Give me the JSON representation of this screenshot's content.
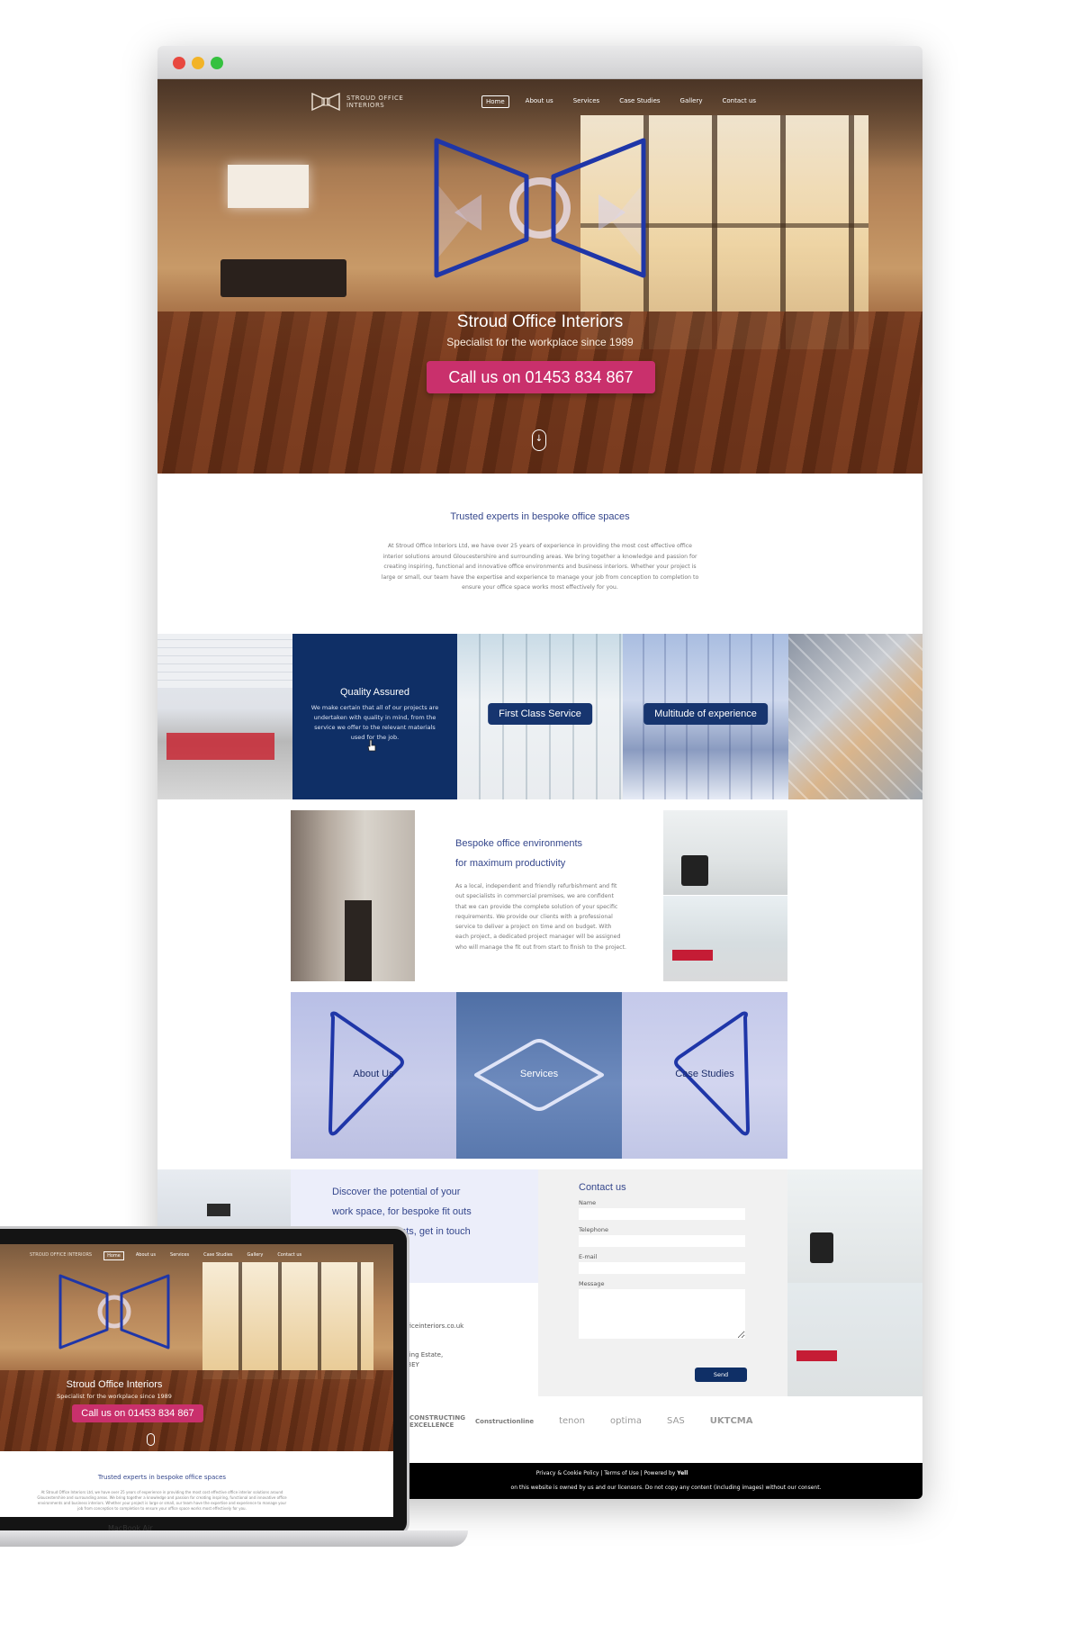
{
  "site": {
    "logo_text": "STROUD OFFICE INTERIORS",
    "nav": [
      "Home",
      "About us",
      "Services",
      "Case Studies",
      "Gallery",
      "Contact us"
    ],
    "active_nav": "Home"
  },
  "hero": {
    "title": "Stroud Office Interiors",
    "subtitle": "Specialist for the workplace since 1989",
    "cta": "Call us on 01453 834 867",
    "scroll_icon": "arrow-down-icon"
  },
  "intro": {
    "title": "Trusted experts in bespoke office spaces",
    "text": "At Stroud Office Interiors Ltd, we have over 25 years of experience in providing the most cost effective office interior solutions around Gloucestershire and surrounding areas. We bring together a knowledge and passion for creating inspiring, functional and innovative office environments and business interiors. Whether your project is large or small, our team have the expertise and experience to manage your job from conception to completion to ensure your office space works most effectively for you."
  },
  "features": {
    "quality_title": "Quality Assured",
    "quality_text": "We make certain that all of our projects are undertaken with quality in mind, from the service we offer to the relevant materials used for the job.",
    "service_label": "First Class Service",
    "experience_label": "Multitude of experience"
  },
  "bespoke": {
    "title_line1": "Bespoke office environments",
    "title_line2": "for maximum productivity",
    "text": "As a local, independent and friendly refurbishment and fit out specialists in commercial premises, we are confident that we can provide the complete solution of your specific requirements. We provide our clients with a professional service to deliver a project on time and on budget. With each project, a dedicated project manager will be assigned who will manage the fit out from start to finish to the project."
  },
  "tiles": [
    "About Us",
    "Services",
    "Case Studies"
  ],
  "discover": {
    "line1": "Discover the potential of your",
    "line2": "work space, for bespoke fit outs",
    "line3": "ents, get in touch"
  },
  "contact": {
    "title": "Contact us",
    "fields": [
      "Name",
      "Telephone",
      "E-mail",
      "Message"
    ],
    "send": "Send",
    "email_fragment": "officeinteriors.co.uk",
    "address_fragment1": "ading Estate,",
    "address_fragment2": "5 3EY"
  },
  "logos": [
    "CONSTRUCTING EXCELLENCE",
    "Constructionline",
    "tenon",
    "optima",
    "SAS",
    "UKTCMA"
  ],
  "footer": {
    "links": "Privacy & Cookie Policy  |  Terms of Use  |  Powered by",
    "powered": "Yell",
    "copyright": "on this website is owned by us and our licensors. Do not copy any content (including images) without our consent."
  },
  "laptop": {
    "label": "MacBook Air"
  },
  "colors": {
    "navy": "#0f2f66",
    "accent_pink": "#c9306c",
    "heading_blue": "#35478c",
    "tile_lavender": "#c4c9ea"
  }
}
